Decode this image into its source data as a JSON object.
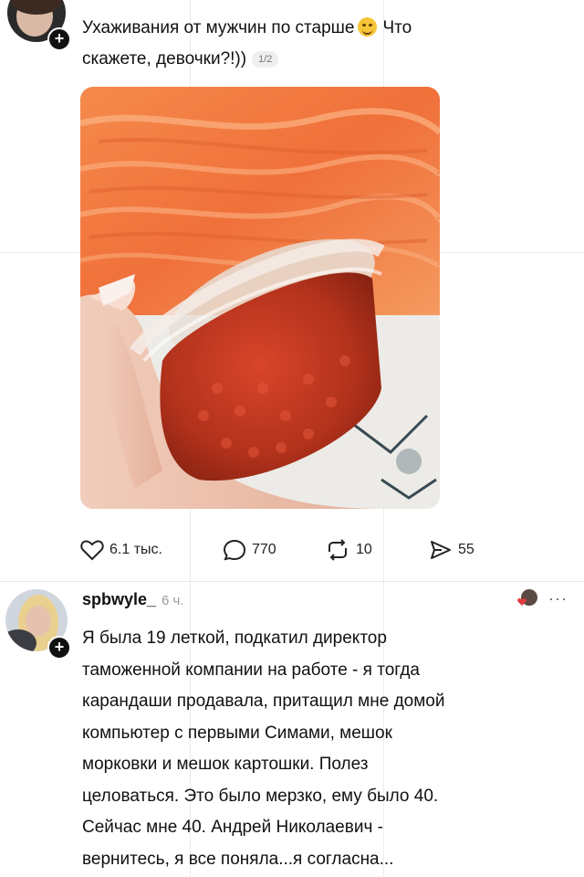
{
  "post": {
    "text_line1": "Ухаживания от мужчин по старше",
    "text_after_emoji": "Что",
    "text_line2": "скажете, девочки?!))",
    "image_counter": "1/2",
    "emoji": "grinning-face-emoji"
  },
  "actions": {
    "likes": "6.1 тыс.",
    "comments": "770",
    "reposts": "10",
    "shares": "55"
  },
  "comment": {
    "username": "spbwyle_",
    "time": "6 ч.",
    "more": "···",
    "lines": [
      "Я была 19 леткой, подкатил директор",
      "таможенной компании на работе - я тогда",
      "карандаши продавала, притащил мне домой",
      "компьютер с первыми Симами, мешок",
      "морковки и мешок картошки. Полез",
      "целоваться. Это было мерзко, ему было 40.",
      "Сейчас мне 40. Андрей Николаевич -",
      "вернитесь, я все поняла...я согласна..."
    ]
  },
  "colors": {
    "salmon": "#f2773f",
    "caviar": "#b8321c",
    "accent_red": "#e0393e"
  }
}
